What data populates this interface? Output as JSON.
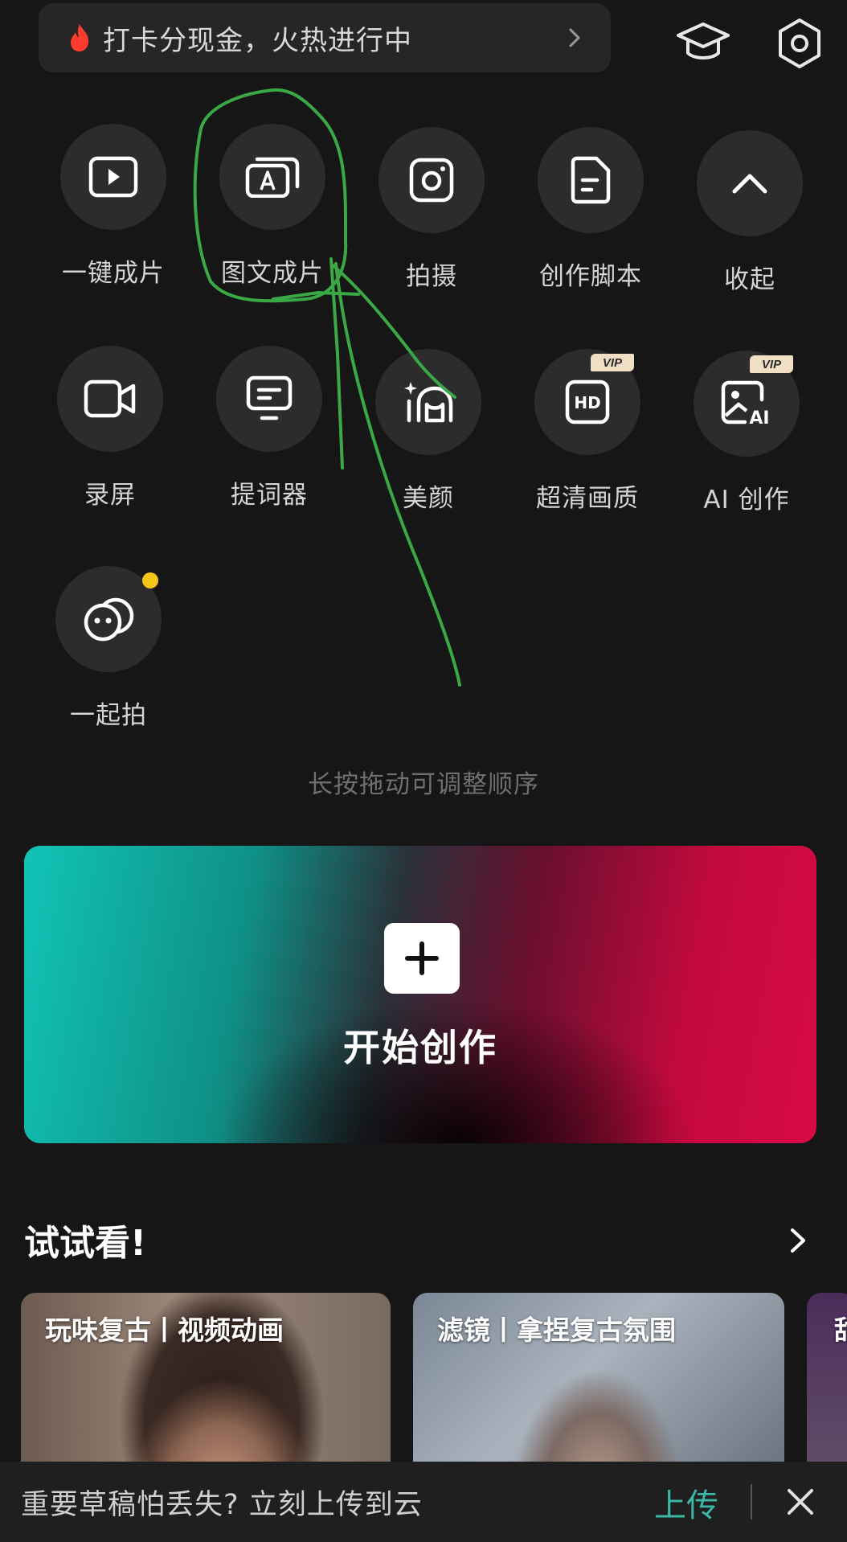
{
  "banner": {
    "text": "打卡分现金，火热进行中"
  },
  "tools_row1": [
    {
      "label": "一键成片",
      "icon": "play-icon"
    },
    {
      "label": "图文成片",
      "icon": "text-image-icon"
    },
    {
      "label": "拍摄",
      "icon": "camera-icon"
    },
    {
      "label": "创作脚本",
      "icon": "script-doc-icon"
    },
    {
      "label": "收起",
      "icon": "chevron-up-icon"
    }
  ],
  "tools_row2": [
    {
      "label": "录屏",
      "icon": "video-record-icon"
    },
    {
      "label": "提词器",
      "icon": "teleprompter-icon"
    },
    {
      "label": "美颜",
      "icon": "beauty-icon"
    },
    {
      "label": "超清画质",
      "icon": "hd-icon",
      "badge": "VIP"
    },
    {
      "label": "AI 创作",
      "icon": "ai-image-icon",
      "badge": "VIP"
    }
  ],
  "tools_row3": [
    {
      "label": "一起拍",
      "icon": "together-icon"
    }
  ],
  "hint": "长按拖动可调整顺序",
  "create": {
    "label": "开始创作"
  },
  "try_section": {
    "title": "试试看!",
    "cards": [
      {
        "title": "玩味复古丨视频动画"
      },
      {
        "title": "滤镜丨拿捏复古氛围"
      },
      {
        "title": "甜"
      }
    ]
  },
  "bottom_bar": {
    "message": "重要草稿怕丢失? 立刻上传到云",
    "upload_label": "上传"
  },
  "colors": {
    "background": "#161616",
    "accent_green": "#3ab7a6",
    "vip_badge": "#f1dfc5",
    "dot": "#f5c518"
  }
}
